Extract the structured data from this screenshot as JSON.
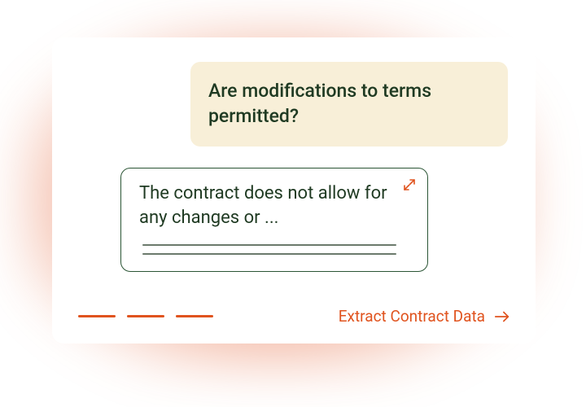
{
  "user_query": "Are modifications to terms permitted?",
  "response_preview": "The contract does not allow for any changes or ...",
  "cta_label": "Extract Contract Data",
  "colors": {
    "accent": "#e0531e",
    "ink": "#1f3a22",
    "bubble_bg": "#f8efd8",
    "line": "#6b7a6c"
  }
}
